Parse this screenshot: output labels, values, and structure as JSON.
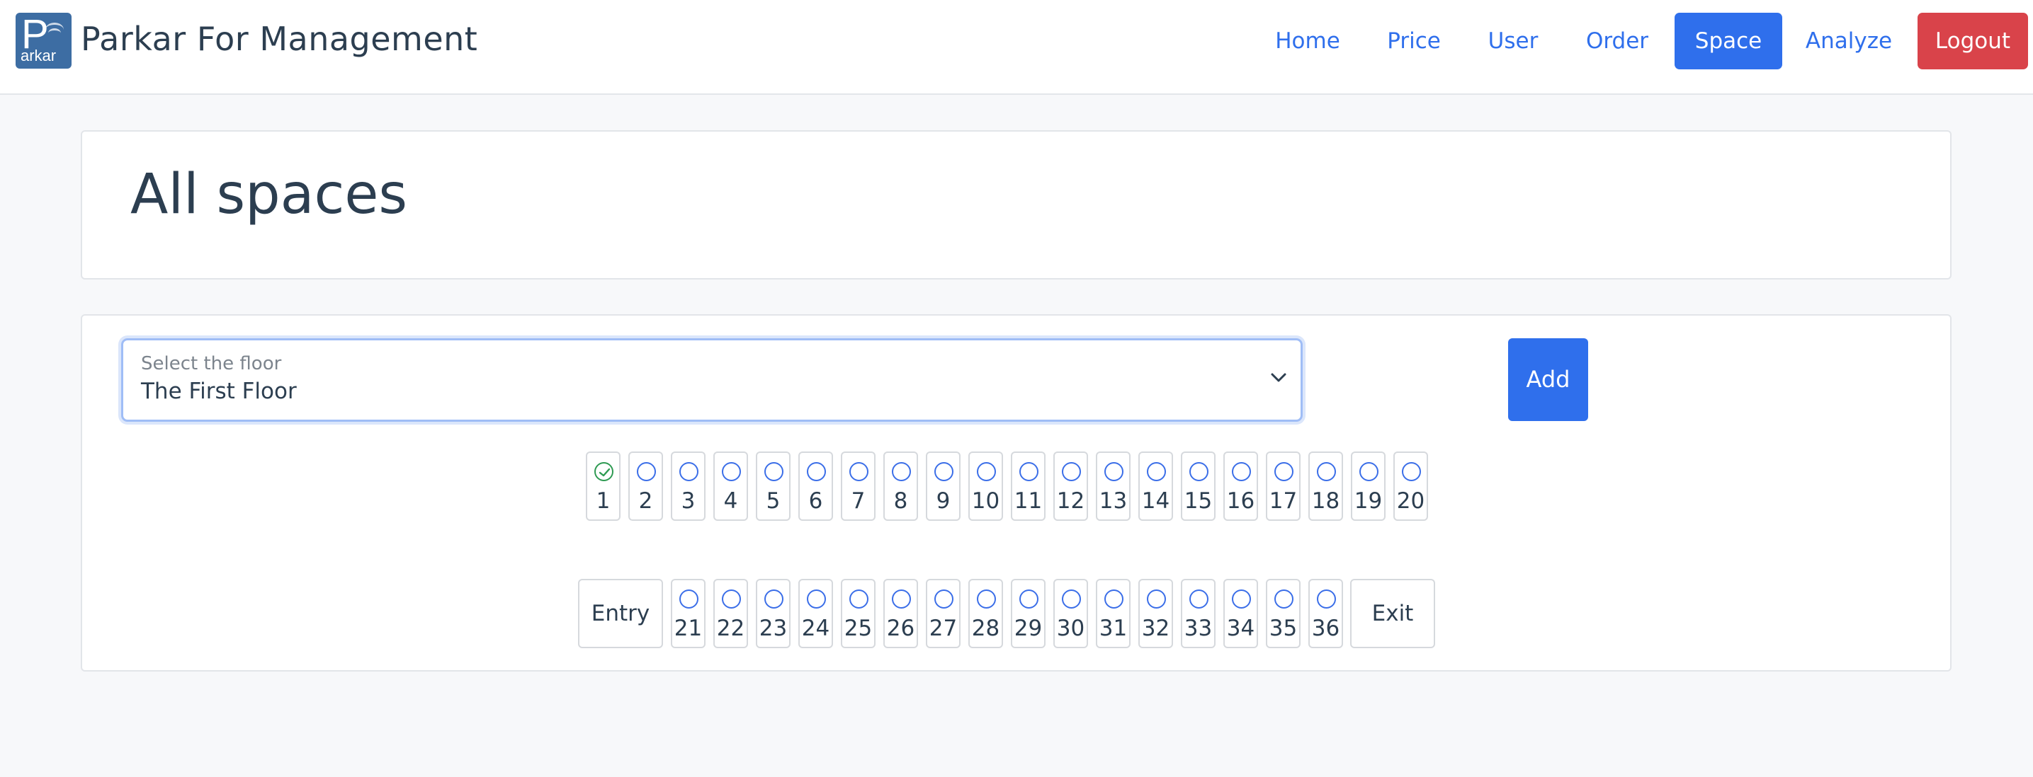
{
  "brand": {
    "logo_big": "P",
    "logo_small": "arkar",
    "name": "Parkar For Management"
  },
  "nav": {
    "items": [
      {
        "label": "Home"
      },
      {
        "label": "Price"
      },
      {
        "label": "User"
      },
      {
        "label": "Order"
      },
      {
        "label": "Space",
        "active": true
      },
      {
        "label": "Analyze"
      }
    ],
    "logout": "Logout"
  },
  "header": {
    "title": "All spaces"
  },
  "floor": {
    "caption": "Select the floor",
    "value": "The First Floor",
    "add_label": "Add"
  },
  "gates": {
    "entry": "Entry",
    "exit": "Exit"
  },
  "spaces": {
    "row1": [
      {
        "num": "1",
        "status": "occupied"
      },
      {
        "num": "2",
        "status": "free"
      },
      {
        "num": "3",
        "status": "free"
      },
      {
        "num": "4",
        "status": "free"
      },
      {
        "num": "5",
        "status": "free"
      },
      {
        "num": "6",
        "status": "free"
      },
      {
        "num": "7",
        "status": "free"
      },
      {
        "num": "8",
        "status": "free"
      },
      {
        "num": "9",
        "status": "free"
      },
      {
        "num": "10",
        "status": "free"
      },
      {
        "num": "11",
        "status": "free"
      },
      {
        "num": "12",
        "status": "free"
      },
      {
        "num": "13",
        "status": "free"
      },
      {
        "num": "14",
        "status": "free"
      },
      {
        "num": "15",
        "status": "free"
      },
      {
        "num": "16",
        "status": "free"
      },
      {
        "num": "17",
        "status": "free"
      },
      {
        "num": "18",
        "status": "free"
      },
      {
        "num": "19",
        "status": "free"
      },
      {
        "num": "20",
        "status": "free"
      }
    ],
    "row2": [
      {
        "num": "21",
        "status": "free"
      },
      {
        "num": "22",
        "status": "free"
      },
      {
        "num": "23",
        "status": "free"
      },
      {
        "num": "24",
        "status": "free"
      },
      {
        "num": "25",
        "status": "free"
      },
      {
        "num": "26",
        "status": "free"
      },
      {
        "num": "27",
        "status": "free"
      },
      {
        "num": "28",
        "status": "free"
      },
      {
        "num": "29",
        "status": "free"
      },
      {
        "num": "30",
        "status": "free"
      },
      {
        "num": "31",
        "status": "free"
      },
      {
        "num": "32",
        "status": "free"
      },
      {
        "num": "33",
        "status": "free"
      },
      {
        "num": "34",
        "status": "free"
      },
      {
        "num": "35",
        "status": "free"
      },
      {
        "num": "36",
        "status": "free"
      }
    ]
  },
  "colors": {
    "primary": "#2f6fec",
    "danger": "#d9434a",
    "success": "#2e9a52",
    "free_ring": "#3b6ee8"
  }
}
